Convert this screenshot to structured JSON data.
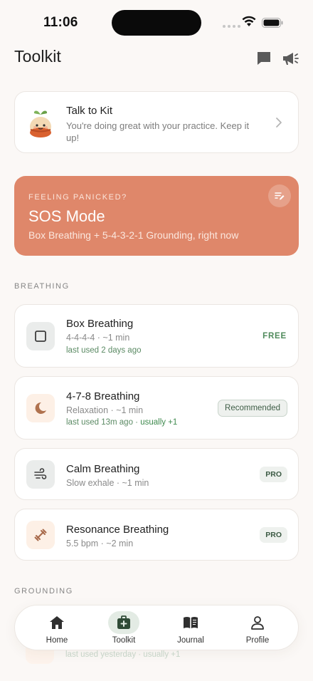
{
  "status_bar": {
    "time": "11:06"
  },
  "header": {
    "title": "Toolkit",
    "icons": [
      "chat-icon",
      "megaphone-icon"
    ]
  },
  "kit": {
    "title": "Talk to Kit",
    "subtitle": "You're doing great with your practice. Keep it up!"
  },
  "sos": {
    "eyebrow": "FEELING PANICKED?",
    "title": "SOS Mode",
    "subtitle": "Box Breathing + 5-4-3-2-1 Grounding, right now",
    "color": "#df876a"
  },
  "sections": {
    "breathing": "BREATHING",
    "grounding": "GROUNDING"
  },
  "tools": [
    {
      "title": "Box Breathing",
      "meta": "4-4-4-4 · ~1 min",
      "used": "last used 2 days ago",
      "used_extra": "",
      "tag": "FREE",
      "icon": "square-icon"
    },
    {
      "title": "4-7-8 Breathing",
      "meta": "Relaxation · ~1 min",
      "used": "last used 13m ago · ",
      "used_extra": "usually +1",
      "tag": "Recommended",
      "icon": "moon-icon"
    },
    {
      "title": "Calm Breathing",
      "meta": "Slow exhale · ~1 min",
      "used": "",
      "used_extra": "",
      "tag": "PRO",
      "icon": "wind-icon"
    },
    {
      "title": "Resonance Breathing",
      "meta": "5.5 bpm · ~2 min",
      "used": "",
      "used_extra": "",
      "tag": "PRO",
      "icon": "dumbbell-icon"
    }
  ],
  "partial_row": {
    "text": "last used yesterday · usually +1"
  },
  "tabbar": {
    "tabs": [
      {
        "label": "Home",
        "icon": "home-icon"
      },
      {
        "label": "Toolkit",
        "icon": "first-aid-kit-icon",
        "active": true
      },
      {
        "label": "Journal",
        "icon": "book-icon"
      },
      {
        "label": "Profile",
        "icon": "person-icon"
      }
    ]
  },
  "colors": {
    "accent": "#df876a",
    "green": "#4f8a5b",
    "background": "#fbf8f6"
  }
}
